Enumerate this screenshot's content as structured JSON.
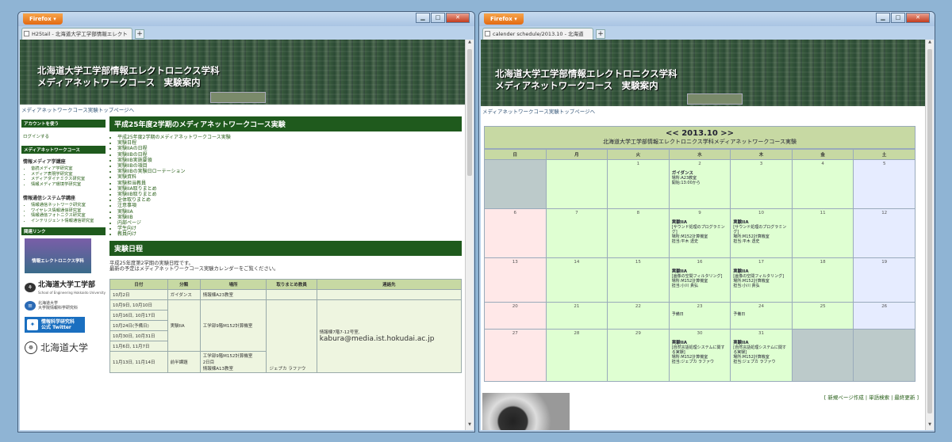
{
  "windows": [
    {
      "browser_button": "Firefox ▾",
      "controls": [
        "▁",
        "□",
        "✕"
      ],
      "tab_title": "H25tail - 北海道大学工学部情報エレクト",
      "new_tab": "+",
      "banner_line1": "北海道大学工学部情報エレクトロニクス学科",
      "banner_line2": "メディアネットワークコース　実験案内",
      "breadcrumb": "メディアネットワークコース実験トップページへ",
      "sidebar": {
        "account_head": "アカウントを使う",
        "login": "ログインする",
        "course_head": "メディアネットワークコース",
        "group1_title": "情報メディア学講座",
        "group1_items": [
          "音読メディア学研究室",
          "メディア表現学研究室",
          "メディアダイナミクス研究室",
          "情報メディア環境学研究室"
        ],
        "group2_title": "情報通信システム学講座",
        "group2_items": [
          "情報通信ネットワーク研究室",
          "ワイヤレス情報通信研究室",
          "情報通信フォトニクス研究室",
          "インテリジェント情報通信研究室"
        ],
        "related_head": "関連リンク",
        "banner_img": "情報エレクトロニクス学科",
        "hu_eng_name": "北海道大学工学部",
        "hu_eng_sub": "School of Engineering Hokkaido University",
        "ist_name": "北海道大学",
        "ist_sub": "大学院情報科学研究科",
        "twitter_line1": "情報科学研究科",
        "twitter_line2": "公式 Twitter",
        "hokudai": "北海道大学"
      },
      "main": {
        "section1": "平成25年度2学期のメディアネットワークコース実験",
        "toc_top1": "平成25年度2学期のメディアネットワークコース実験",
        "toc_top2": "実験日程",
        "toc_2a": "実験IIAの日程",
        "toc_top3": "実験IIBの日程",
        "toc_3a": "実験IIB実施要領",
        "toc_3b": "実験IIBの項目",
        "toc_3c": "実験IIBの実験日ローテーション",
        "toc_top4": "実験資料",
        "toc_top5": "実験担当教員",
        "toc_5a": "実験IIA取りまとめ",
        "toc_5b": "実験IIB取りまとめ",
        "toc_5c": "全体取りまとめ",
        "toc_top6": "注意事項",
        "toc_6a": "実験IIA",
        "toc_6b": "実験IIB",
        "toc_top7": "内部ページ",
        "toc_7a": "学生向け",
        "toc_7b": "教員向け",
        "section2": "実験日程",
        "intro1": "平成25年度第2学期の実験日程です。",
        "intro2": "最新の予定はメディアネットワークコース実験カレンダーをご覧ください。",
        "table_headers": [
          "日付",
          "分類",
          "場所",
          "取りまとめ教員",
          "連絡先"
        ],
        "table_rows": [
          [
            "10月2日",
            "ガイダンス",
            "情報棟A23教室"
          ],
          [
            "10月9日, 10月10日",
            "",
            ""
          ],
          [
            "10月16日, 10月17日",
            "実験IIA",
            "工学部9階M152計算機室"
          ],
          [
            "10月24日(予備日)",
            "",
            ""
          ],
          [
            "10月30日, 10月31日",
            "",
            ""
          ],
          [
            "11月6日, 11月7日",
            "",
            ""
          ],
          [
            "11月13日, 11月14日",
            "前半課題",
            "工学部9階M152計算機室"
          ]
        ],
        "teacher": "ジェプカ ラファウ",
        "contact_room": "情報棟7階7-12号室,",
        "contact_email": "kabura@media.ist.hokudai.ac.jp",
        "extra_row": "2日目",
        "extra_row2": "情報棟A13教室"
      }
    },
    {
      "browser_button": "Firefox ▾",
      "controls": [
        "▁",
        "□",
        "✕"
      ],
      "tab_title": "calender schedule/2013.10 - 北海道",
      "new_tab": "+",
      "banner_line1": "北海道大学工学部情報エレクトロニクス学科",
      "banner_line2": "メディアネットワークコース　実験案内",
      "breadcrumb": "メディアネットワークコース実験トップページへ",
      "calendar": {
        "month_nav": "<< 2013.10 >>",
        "subtitle": "北海道大学工学部情報エレクトロニクス学科メディアネットワークコース実験",
        "weekdays": [
          "日",
          "月",
          "火",
          "水",
          "木",
          "金",
          "土"
        ],
        "weeks": [
          [
            {
              "d": "",
              "na": true
            },
            {
              "d": "",
              "na": false
            },
            {
              "d": "1"
            },
            {
              "d": "2",
              "title": "ガイダンス",
              "lines": [
                "場所:A23教室",
                "開始:13:00から"
              ]
            },
            {
              "d": "3"
            },
            {
              "d": "4"
            },
            {
              "d": "5"
            }
          ],
          [
            {
              "d": "6"
            },
            {
              "d": "7"
            },
            {
              "d": "8"
            },
            {
              "d": "9",
              "title": "実験IIA",
              "lines": [
                "[サウンド処理のプログラミング]",
                "場所:M152計算機室",
                "担当:平木 透史"
              ]
            },
            {
              "d": "10",
              "title": "実験IIA",
              "lines": [
                "[サウンド処理のプログラミング]",
                "場所:M152計算機室",
                "担当:平木 透史"
              ]
            },
            {
              "d": "11"
            },
            {
              "d": "12"
            }
          ],
          [
            {
              "d": "13"
            },
            {
              "d": "14"
            },
            {
              "d": "15"
            },
            {
              "d": "16",
              "title": "実験IIA",
              "lines": [
                "[画像の空間フィルタリング]",
                "場所:M152計算機室",
                "担当:小川 貴弘"
              ]
            },
            {
              "d": "17",
              "title": "実験IIA",
              "lines": [
                "[画像の空間フィルタリング]",
                "場所:M152計算機室",
                "担当:小川 貴弘"
              ]
            },
            {
              "d": "18"
            },
            {
              "d": "19"
            }
          ],
          [
            {
              "d": "20"
            },
            {
              "d": "21"
            },
            {
              "d": "22"
            },
            {
              "d": "23",
              "title": "",
              "lines": [
                "予備日"
              ]
            },
            {
              "d": "24",
              "title": "",
              "lines": [
                "予備日"
              ]
            },
            {
              "d": "25"
            },
            {
              "d": "26"
            }
          ],
          [
            {
              "d": "27"
            },
            {
              "d": "28"
            },
            {
              "d": "29"
            },
            {
              "d": "30",
              "title": "実験IIA",
              "lines": [
                "[自然言語処理システムに関する実験]",
                "場所:M152計算機室",
                "担当:ジェプカ ラファウ"
              ]
            },
            {
              "d": "31",
              "title": "実験IIA",
              "lines": [
                "[自然言語処理システムに関する実験]",
                "場所:M152計算機室",
                "担当:ジェプカ ラファウ"
              ]
            },
            {
              "d": "",
              "na": true
            },
            {
              "d": "",
              "na": true
            }
          ]
        ],
        "footer": "[ 新規ページ作成 | 単語検索 | 最終更新 ]"
      }
    }
  ]
}
